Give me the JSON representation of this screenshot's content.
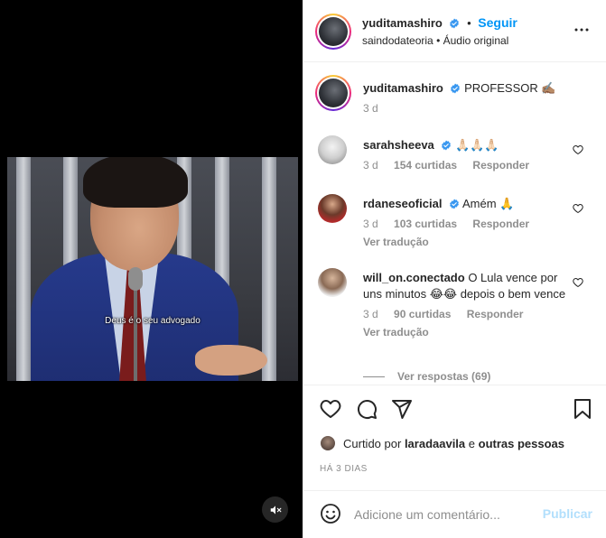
{
  "post": {
    "author": "yuditamashiro",
    "follow_label": "Seguir",
    "origin": "saindodateoria",
    "separator": "•",
    "audio": "Áudio original"
  },
  "video": {
    "subtitle": "Deus é o seu advogado"
  },
  "caption": {
    "username": "yuditamashiro",
    "text": "PROFESSOR ✍🏽",
    "time": "3 d"
  },
  "comments": [
    {
      "username": "sarahsheeva",
      "verified": true,
      "text": "🙏🏻🙏🏻🙏🏻",
      "time": "3 d",
      "likes": "154 curtidas",
      "reply": "Responder"
    },
    {
      "username": "rdaneseoficial",
      "verified": true,
      "text": "Amém 🙏",
      "time": "3 d",
      "likes": "103 curtidas",
      "reply": "Responder",
      "translate": "Ver tradução"
    },
    {
      "username": "will_on.conectado",
      "verified": false,
      "text": "O Lula vence por uns minutos 😂😂 depois o bem vence",
      "time": "3 d",
      "likes": "90 curtidas",
      "reply": "Responder",
      "translate": "Ver tradução"
    }
  ],
  "view_replies": "Ver respostas (69)",
  "liked_by": {
    "prefix": "Curtido por",
    "user": "laradaavila",
    "connector": "e",
    "others": "outras pessoas"
  },
  "date": "HÁ 3 DIAS",
  "add_comment": {
    "placeholder": "Adicione um comentário...",
    "publish": "Publicar"
  },
  "colors": {
    "link_blue": "#0095f6",
    "publish_disabled": "#b2dffc",
    "verified_blue": "#3897f0",
    "secondary_text": "#8e8e8e"
  },
  "icons": [
    "verified-badge-icon",
    "more-options-icon",
    "heart-icon",
    "comment-icon",
    "share-icon",
    "save-icon",
    "emoji-icon",
    "mute-icon"
  ]
}
